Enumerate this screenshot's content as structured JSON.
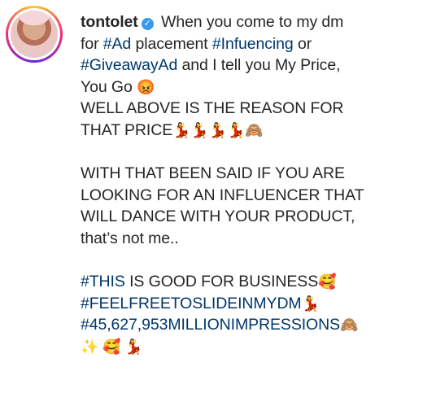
{
  "post": {
    "username": "tontolet",
    "verified_icon": "verified-badge-icon",
    "lines": [
      [
        {
          "t": "When you come to my dm"
        }
      ],
      [
        {
          "t": "for "
        },
        {
          "t": "#Ad",
          "tag": true
        },
        {
          "t": " placement "
        },
        {
          "t": "#Infuencing",
          "tag": true
        },
        {
          "t": " or"
        }
      ],
      [
        {
          "t": "#GiveawayAd",
          "tag": true
        },
        {
          "t": " and I tell you My Price,"
        }
      ],
      [
        {
          "t": "You Go "
        },
        {
          "t": "😡",
          "emoji": true
        }
      ],
      [
        {
          "t": "WELL ABOVE IS THE REASON FOR"
        }
      ],
      [
        {
          "t": "THAT PRICE"
        },
        {
          "t": "💃💃💃💃🙈",
          "emoji": true
        }
      ],
      [],
      [
        {
          "t": "WITH THAT BEEN SAID IF YOU ARE"
        }
      ],
      [
        {
          "t": "LOOKING FOR AN INFLUENCER THAT"
        }
      ],
      [
        {
          "t": "WILL DANCE WITH YOUR PRODUCT,"
        }
      ],
      [
        {
          "t": "that’s not me.."
        }
      ],
      [],
      [
        {
          "t": "#THIS",
          "tag": true
        },
        {
          "t": " IS GOOD FOR BUSINESS"
        },
        {
          "t": "🥰",
          "emoji": true
        }
      ],
      [
        {
          "t": "#FEELFREETOSLIDEINMYDM",
          "tag": true
        },
        {
          "t": "💃",
          "emoji": true
        }
      ],
      [
        {
          "t": "#45,627,953MILLIONIMPRESSIONS",
          "tag": true
        },
        {
          "t": "🙈",
          "emoji": true
        }
      ],
      [
        {
          "t": "✨ 🥰 💃",
          "emoji": true
        }
      ]
    ]
  }
}
